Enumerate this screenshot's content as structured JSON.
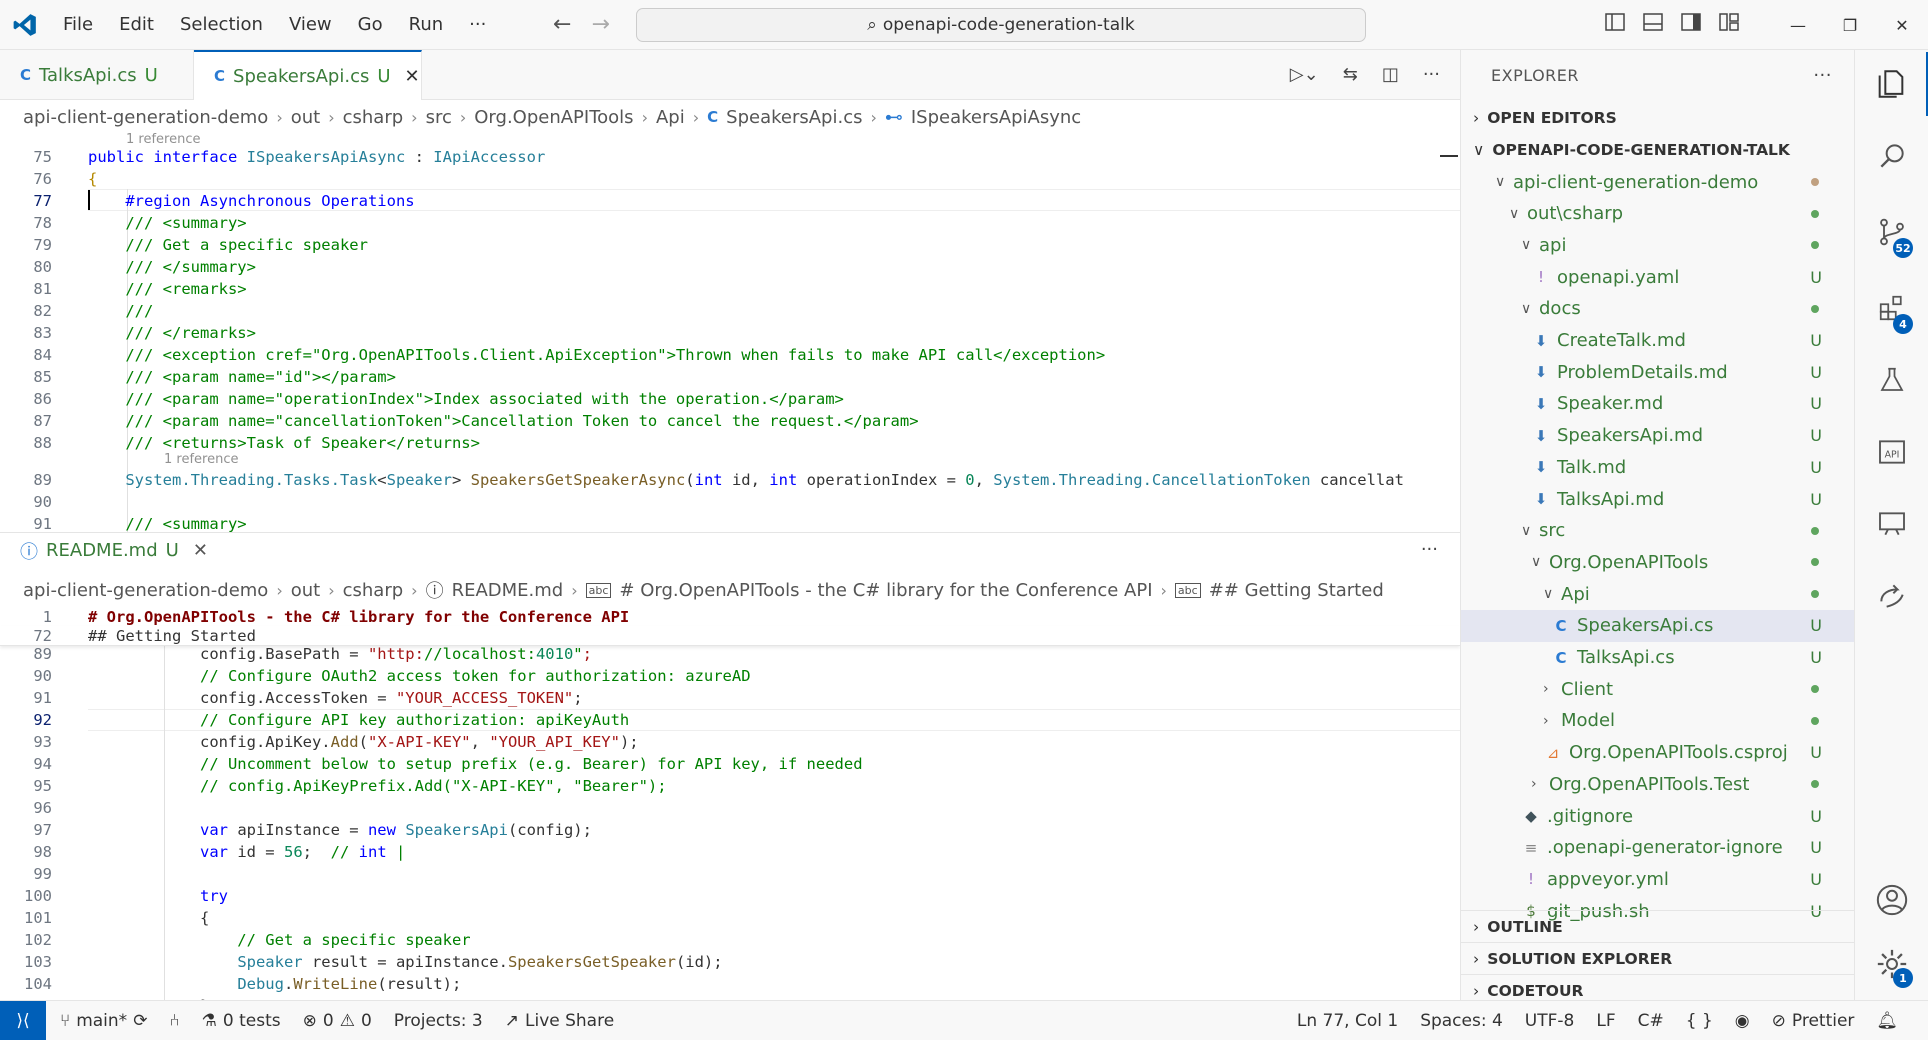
{
  "titlebar": {
    "menu": [
      "File",
      "Edit",
      "Selection",
      "View",
      "Go",
      "Run",
      "···"
    ],
    "search": "openapi-code-generation-talk",
    "controls": [
      "—",
      "❐",
      "✕"
    ]
  },
  "tabs": [
    {
      "name": "TalksApi.cs",
      "status": "U",
      "active": false
    },
    {
      "name": "SpeakersApi.cs",
      "status": "U",
      "active": true
    }
  ],
  "breadcrumb1": [
    "api-client-generation-demo",
    "out",
    "csharp",
    "src",
    "Org.OpenAPITools",
    "Api",
    "SpeakersApi.cs",
    "ISpeakersApiAsync"
  ],
  "editor1": {
    "codelens_top": "1 reference",
    "codelens_mid": "1 reference",
    "lines": [
      {
        "n": "75",
        "t": "public interface ISpeakersApiAsync : IApiAccessor"
      },
      {
        "n": "76",
        "t": "{"
      },
      {
        "n": "77",
        "t": "    #region Asynchronous Operations"
      },
      {
        "n": "78",
        "t": "    /// <summary>"
      },
      {
        "n": "79",
        "t": "    /// Get a specific speaker"
      },
      {
        "n": "80",
        "t": "    /// </summary>"
      },
      {
        "n": "81",
        "t": "    /// <remarks>"
      },
      {
        "n": "82",
        "t": "    ///"
      },
      {
        "n": "83",
        "t": "    /// </remarks>"
      },
      {
        "n": "84",
        "t": "    /// <exception cref=\"Org.OpenAPITools.Client.ApiException\">Thrown when fails to make API call</exception>"
      },
      {
        "n": "85",
        "t": "    /// <param name=\"id\"></param>"
      },
      {
        "n": "86",
        "t": "    /// <param name=\"operationIndex\">Index associated with the operation.</param>"
      },
      {
        "n": "87",
        "t": "    /// <param name=\"cancellationToken\">Cancellation Token to cancel the request.</param>"
      },
      {
        "n": "88",
        "t": "    /// <returns>Task of Speaker</returns>"
      },
      {
        "n": "89",
        "t": "    System.Threading.Tasks.Task<Speaker> SpeakersGetSpeakerAsync(int id, int operationIndex = 0, System.Threading.CancellationToken cancellat"
      },
      {
        "n": "90",
        "t": ""
      },
      {
        "n": "91",
        "t": "    /// <summary>"
      }
    ]
  },
  "pane2": {
    "tab_name": "README.md",
    "tab_status": "U",
    "more": "···"
  },
  "breadcrumb2": [
    "api-client-generation-demo",
    "out",
    "csharp",
    "README.md",
    "# Org.OpenAPITools - the C# library for the Conference API",
    "## Getting Started"
  ],
  "editor2": {
    "sticky": [
      {
        "n": "1",
        "t": "# Org.OpenAPITools - the C# library for the Conference API"
      },
      {
        "n": "72",
        "t": "## Getting Started"
      }
    ],
    "lines": [
      {
        "n": "89",
        "t": "            config.BasePath = \"http://localhost:4010\";"
      },
      {
        "n": "90",
        "t": "            // Configure OAuth2 access token for authorization: azureAD"
      },
      {
        "n": "91",
        "t": "            config.AccessToken = \"YOUR_ACCESS_TOKEN\";"
      },
      {
        "n": "92",
        "t": "            // Configure API key authorization: apiKeyAuth"
      },
      {
        "n": "93",
        "t": "            config.ApiKey.Add(\"X-API-KEY\", \"YOUR_API_KEY\");"
      },
      {
        "n": "94",
        "t": "            // Uncomment below to setup prefix (e.g. Bearer) for API key, if needed"
      },
      {
        "n": "95",
        "t": "            // config.ApiKeyPrefix.Add(\"X-API-KEY\", \"Bearer\");"
      },
      {
        "n": "96",
        "t": ""
      },
      {
        "n": "97",
        "t": "            var apiInstance = new SpeakersApi(config);"
      },
      {
        "n": "98",
        "t": "            var id = 56;  // int |"
      },
      {
        "n": "99",
        "t": ""
      },
      {
        "n": "100",
        "t": "            try"
      },
      {
        "n": "101",
        "t": "            {"
      },
      {
        "n": "102",
        "t": "                // Get a specific speaker"
      },
      {
        "n": "103",
        "t": "                Speaker result = apiInstance.SpeakersGetSpeaker(id);"
      },
      {
        "n": "104",
        "t": "                Debug.WriteLine(result);"
      },
      {
        "n": "105",
        "t": "            }"
      }
    ]
  },
  "explorer": {
    "title": "EXPLORER",
    "more": "···",
    "open_editors": "OPEN EDITORS",
    "root": "OPENAPI-CODE-GENERATION-TALK",
    "items": [
      {
        "label": "api-client-generation-demo",
        "indent": 1,
        "chev": "∨",
        "mark": "dot-ochre"
      },
      {
        "label": "out\\csharp",
        "indent": 2,
        "chev": "∨",
        "mark": "dot"
      },
      {
        "label": "api",
        "indent": 3,
        "chev": "∨",
        "mark": "dot"
      },
      {
        "label": "openapi.yaml",
        "indent": 4,
        "icon": "!",
        "mark": "U"
      },
      {
        "label": "docs",
        "indent": 3,
        "chev": "∨",
        "mark": "dot"
      },
      {
        "label": "CreateTalk.md",
        "indent": 4,
        "icon": "⬇",
        "mark": "U"
      },
      {
        "label": "ProblemDetails.md",
        "indent": 4,
        "icon": "⬇",
        "mark": "U"
      },
      {
        "label": "Speaker.md",
        "indent": 4,
        "icon": "⬇",
        "mark": "U"
      },
      {
        "label": "SpeakersApi.md",
        "indent": 4,
        "icon": "⬇",
        "mark": "U"
      },
      {
        "label": "Talk.md",
        "indent": 4,
        "icon": "⬇",
        "mark": "U"
      },
      {
        "label": "TalksApi.md",
        "indent": 4,
        "icon": "⬇",
        "mark": "U"
      },
      {
        "label": "src",
        "indent": 3,
        "chev": "∨",
        "mark": "dot"
      },
      {
        "label": "Org.OpenAPITools",
        "indent": 4,
        "chev": "∨",
        "mark": "dot"
      },
      {
        "label": "Api",
        "indent": 5,
        "chev": "∨",
        "mark": "dot"
      },
      {
        "label": "SpeakersApi.cs",
        "indent": 6,
        "icon": "C",
        "mark": "U",
        "selected": true
      },
      {
        "label": "TalksApi.cs",
        "indent": 6,
        "icon": "C",
        "mark": "U"
      },
      {
        "label": "Client",
        "indent": 5,
        "chev": "›",
        "mark": "dot"
      },
      {
        "label": "Model",
        "indent": 5,
        "chev": "›",
        "mark": "dot"
      },
      {
        "label": "Org.OpenAPITools.csproj",
        "indent": 5,
        "icon": "⊿",
        "mark": "U"
      },
      {
        "label": "Org.OpenAPITools.Test",
        "indent": 4,
        "chev": "›",
        "mark": "dot"
      },
      {
        "label": ".gitignore",
        "indent": 3,
        "icon": "◆",
        "mark": "U"
      },
      {
        "label": ".openapi-generator-ignore",
        "indent": 3,
        "icon": "≡",
        "mark": "U"
      },
      {
        "label": "appveyor.yml",
        "indent": 3,
        "icon": "!",
        "mark": "U"
      },
      {
        "label": "git_push.sh",
        "indent": 3,
        "icon": "$",
        "mark": "U"
      }
    ],
    "outline": "OUTLINE",
    "solution_explorer": "SOLUTION EXPLORER",
    "codetour": "CODETOUR"
  },
  "activity": {
    "scm_badge": "52",
    "ext_badge": "4",
    "settings_badge": "1"
  },
  "status": {
    "branch": "main*",
    "tests": "0 tests",
    "errors": "0",
    "warnings": "0",
    "projects": "Projects: 3",
    "liveshare": "Live Share",
    "position": "Ln 77, Col 1",
    "spaces": "Spaces: 4",
    "encoding": "UTF-8",
    "eol": "LF",
    "lang": "C#",
    "prettier": "Prettier"
  }
}
